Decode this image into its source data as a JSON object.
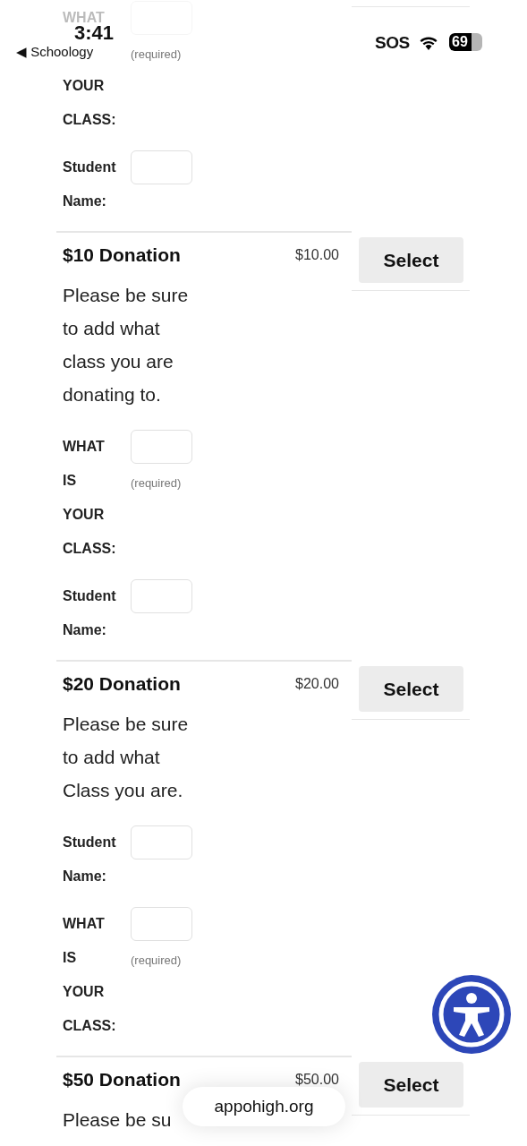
{
  "status_bar": {
    "time": "3:41",
    "back_label": "◀ Schoology",
    "carrier": "SOS",
    "battery": "69"
  },
  "fragment": {
    "fields": [
      {
        "rows": [
          {
            "label": "WHAT",
            "kind": "input",
            "faded": true
          },
          {
            "kind": "note",
            "note": "(required)",
            "faded": false
          },
          {
            "label": "YOUR",
            "faded": false
          },
          {
            "label": "CLASS:",
            "faded": false
          }
        ]
      },
      {
        "rows": [
          {
            "label": "Student",
            "kind": "input",
            "faded": false
          },
          {
            "label": "Name:",
            "faded": false
          }
        ]
      }
    ]
  },
  "products": [
    {
      "title": "$10 Donation",
      "price": "$10.00",
      "button": "Select",
      "description": [
        "Please be sure",
        "to add what",
        "class you are",
        "donating to."
      ],
      "fields": [
        {
          "rows": [
            {
              "label": "WHAT",
              "kind": "input",
              "faded": false
            },
            {
              "label": "IS",
              "kind": "note",
              "note": "(required)",
              "faded": false
            },
            {
              "label": "YOUR",
              "faded": false
            },
            {
              "label": "CLASS:",
              "faded": false
            }
          ]
        },
        {
          "rows": [
            {
              "label": "Student",
              "kind": "input",
              "faded": false
            },
            {
              "label": "Name:",
              "faded": false
            }
          ]
        }
      ]
    },
    {
      "title": "$20 Donation",
      "price": "$20.00",
      "button": "Select",
      "description": [
        "Please be sure",
        "to add what",
        "Class you are."
      ],
      "fields": [
        {
          "rows": [
            {
              "label": "Student",
              "kind": "input",
              "faded": false
            },
            {
              "label": "Name:",
              "faded": false
            }
          ]
        },
        {
          "rows": [
            {
              "label": "WHAT",
              "kind": "input",
              "faded": false
            },
            {
              "label": "IS",
              "kind": "note",
              "note": "(required)",
              "faded": false
            },
            {
              "label": "YOUR",
              "faded": false
            },
            {
              "label": "CLASS:",
              "faded": false
            }
          ]
        }
      ]
    },
    {
      "title": "$50 Donation",
      "price": "$50.00",
      "button": "Select",
      "description": [
        "Please be su"
      ]
    }
  ],
  "url_pill": "appohigh.org"
}
